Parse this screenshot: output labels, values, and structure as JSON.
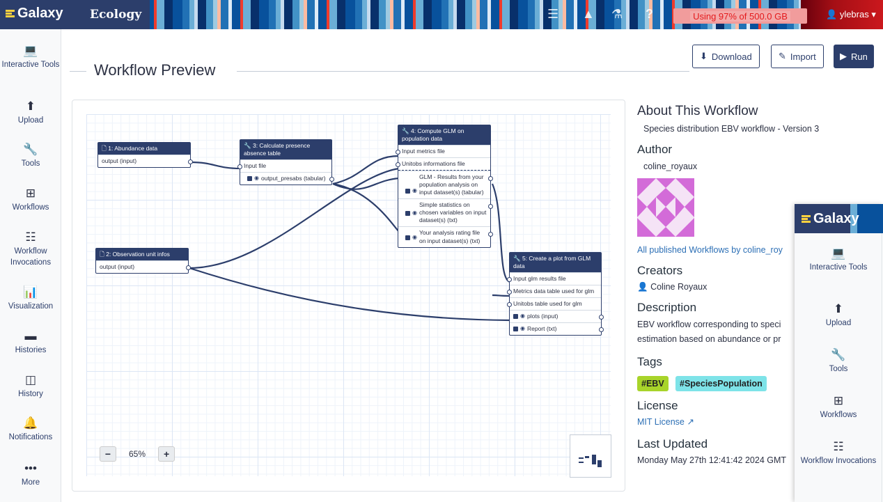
{
  "topbar": {
    "brand": "Galaxy",
    "subbrand": "Ecology",
    "quota": "Using 97% of 500.0 GB",
    "user": "ylebras"
  },
  "nav": {
    "items": [
      {
        "label": "Interactive Tools",
        "icon": "laptop-icon"
      },
      {
        "label": "Upload",
        "icon": "upload-icon"
      },
      {
        "label": "Tools",
        "icon": "wrench-icon"
      },
      {
        "label": "Workflows",
        "icon": "sitemap-icon"
      },
      {
        "label": "Workflow Invocations",
        "icon": "list-icon"
      },
      {
        "label": "Visualization",
        "icon": "chart-icon"
      },
      {
        "label": "Histories",
        "icon": "hdd-icon"
      },
      {
        "label": "History",
        "icon": "columns-icon"
      },
      {
        "label": "Notifications",
        "icon": "bell-icon"
      },
      {
        "label": "More",
        "icon": "ellipsis-icon"
      }
    ]
  },
  "page": {
    "title": "Workflow Preview",
    "download_label": "Download",
    "import_label": "Import",
    "run_label": "Run"
  },
  "workflow": {
    "nodes": {
      "n1": {
        "title": "1: Abundance data",
        "output": "output (input)"
      },
      "n2": {
        "title": "2: Observation unit infos",
        "output": "output (input)"
      },
      "n3": {
        "title": "3: Calculate presence absence table",
        "input": "Input file",
        "output": "output_presabs (tabular)"
      },
      "n4": {
        "title": "4: Compute GLM on population data",
        "inputs": [
          "Input metrics file",
          "Unitobs informations file"
        ],
        "outputs": [
          "GLM - Results from your population analysis on input dataset(s) (tabular)",
          "Simple statistics on chosen variables on input dataset(s) (txt)",
          "Your analysis rating file on input dataset(s) (txt)"
        ]
      },
      "n5": {
        "title": "5: Create a plot from GLM data",
        "inputs": [
          "Input glm results file",
          "Metrics data table used for glm",
          "Unitobs table used for glm"
        ],
        "outputs": [
          "plots (input)",
          "Report (txt)"
        ]
      }
    },
    "zoom": "65%"
  },
  "about": {
    "heading": "About This Workflow",
    "subtitle": "Species distribution EBV workflow - Version 3",
    "author_heading": "Author",
    "author": "coline_royaux",
    "published_link": "All published Workflows by coline_roy",
    "creators_heading": "Creators",
    "creator": "Coline Royaux",
    "description_heading": "Description",
    "description_line1": "EBV workflow corresponding to speci",
    "description_line2": "estimation based on abundance or pr",
    "tags_heading": "Tags",
    "tags": [
      "#EBV",
      "#SpeciesPopulation"
    ],
    "license_heading": "License",
    "license": "MIT License",
    "updated_heading": "Last Updated",
    "updated": "Monday May 27th 12:41:42 2024 GMT"
  },
  "overlay": {
    "brand": "Galaxy",
    "items": [
      "Interactive Tools",
      "Upload",
      "Tools",
      "Workflows",
      "Workflow Invocations"
    ]
  }
}
